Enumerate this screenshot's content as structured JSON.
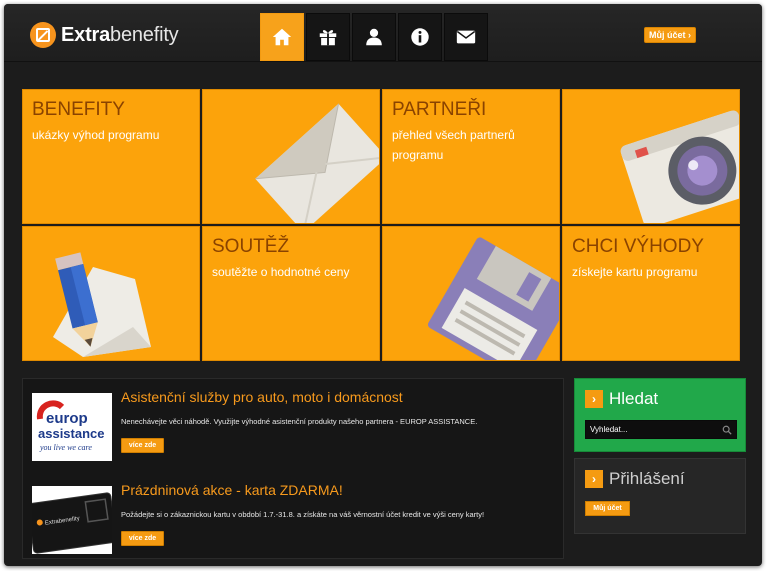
{
  "header": {
    "logo_bold": "Extra",
    "logo_light": "benefity",
    "account_label": "Můj účet ›",
    "nav": [
      {
        "icon": "home-icon"
      },
      {
        "icon": "gift-icon"
      },
      {
        "icon": "user-icon"
      },
      {
        "icon": "info-icon"
      },
      {
        "icon": "envelope-icon"
      }
    ]
  },
  "tiles": {
    "benefity": {
      "title": "BENEFITY",
      "subtitle": "ukázky výhod programu"
    },
    "partneri": {
      "title": "PARTNEŘI",
      "subtitle": "přehled všech partnerů programu"
    },
    "soutez": {
      "title": "SOUTĚŽ",
      "subtitle": "soutěžte o hodnotné ceny"
    },
    "chci": {
      "title": "CHCI VÝHODY",
      "subtitle": "získejte kartu programu"
    }
  },
  "news": [
    {
      "title": "Asistenční služby pro auto, moto i domácnost",
      "text": "Nenechávejte věci náhodě. Využijte výhodné asistenční produkty našeho partnera - EUROP ASSISTANCE.",
      "button": "více zde",
      "logo_line1": "europ",
      "logo_line2": "assistance",
      "logo_tagline": "you live we care"
    },
    {
      "title": "Prázdninová akce - karta ZDARMA!",
      "text": "Požádejte si o zákaznickou kartu v období 1.7.-31.8. a získáte na váš věrnostní účet kredit ve výši ceny karty!",
      "button": "více zde",
      "card_label": "Extrabenefity"
    }
  ],
  "search": {
    "title": "Hledat",
    "placeholder": "Vyhledat..."
  },
  "login": {
    "title": "Přihlášení",
    "button": "Můj účet"
  },
  "colors": {
    "accent": "#fca30b",
    "green": "#21a84a",
    "background": "#1c1c1c"
  }
}
